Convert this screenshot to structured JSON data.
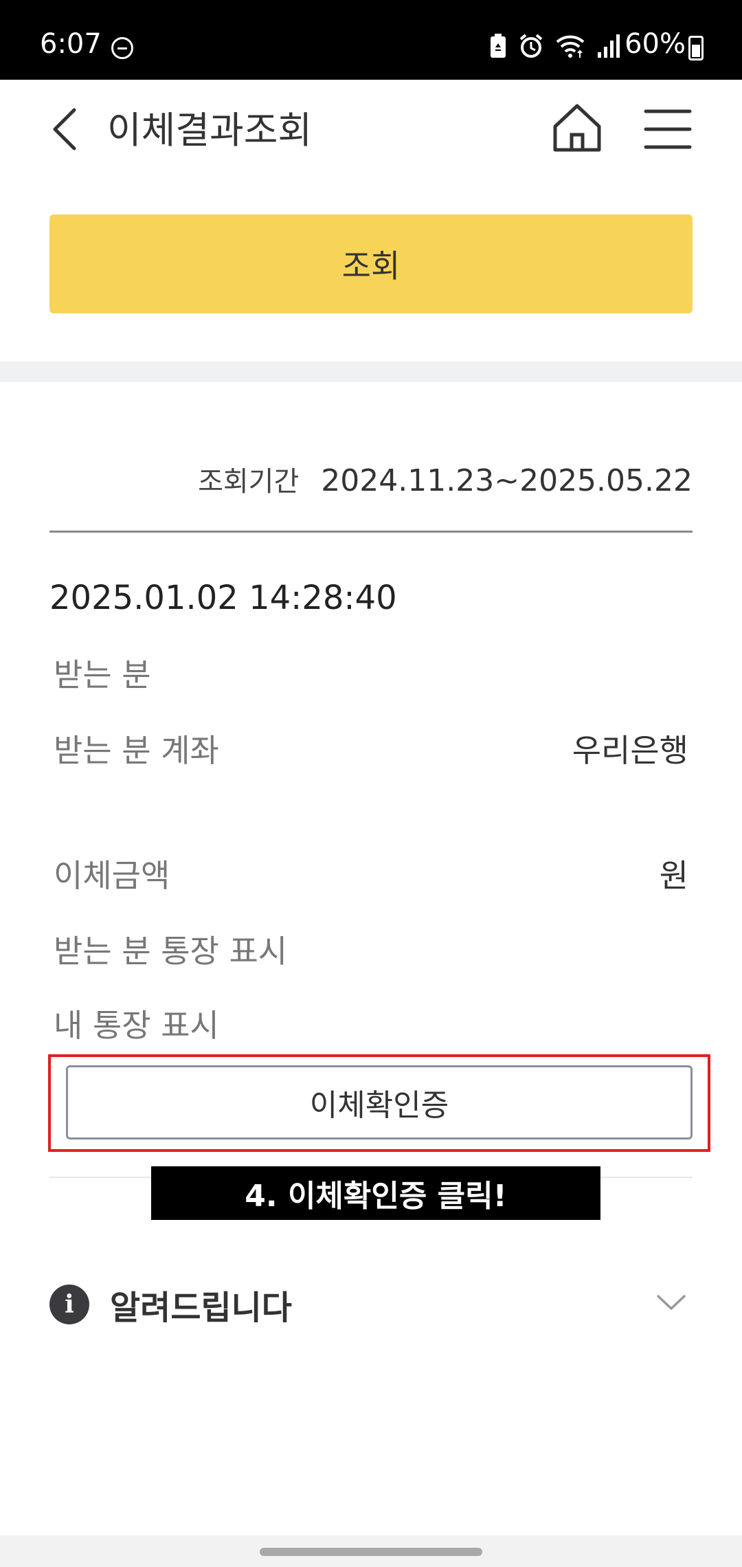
{
  "status_bar": {
    "time": "6:07",
    "battery_percent": "60%",
    "icons": [
      "do-not-disturb-icon",
      "battery-saver-icon",
      "alarm-icon",
      "wifi-icon",
      "signal-icon",
      "battery-icon"
    ]
  },
  "header": {
    "title": "이체결과조회",
    "icons": [
      "back-arrow-icon",
      "home-icon",
      "menu-icon"
    ]
  },
  "search_button": {
    "label": "조회"
  },
  "period": {
    "label": "조회기간",
    "value": "2024.11.23~2025.05.22"
  },
  "transaction": {
    "datetime": "2025.01.02 14:28:40",
    "rows": [
      {
        "label": "받는 분",
        "value": ""
      },
      {
        "label": "받는 분 계좌",
        "value": "우리은행"
      },
      {
        "label": "이체금액",
        "value": "원"
      },
      {
        "label": "받는 분 통장 표시",
        "value": ""
      },
      {
        "label": "내 통장 표시",
        "value": ""
      }
    ],
    "confirm_button": "이체확인증"
  },
  "tutorial_caption": "4. 이체확인증 클릭!",
  "notice": {
    "title": "알려드립니다",
    "icon": "info-icon"
  },
  "colors": {
    "primary_button": "#f7d358",
    "highlight_border": "#e02020",
    "caption_background": "#000000"
  }
}
